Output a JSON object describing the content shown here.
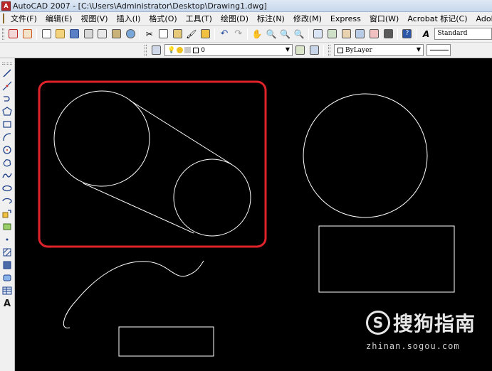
{
  "window": {
    "title": "AutoCAD 2007 - [C:\\Users\\Administrator\\Desktop\\Drawing1.dwg]"
  },
  "menu": {
    "items": [
      "文件(F)",
      "编辑(E)",
      "视图(V)",
      "插入(I)",
      "格式(O)",
      "工具(T)",
      "绘图(D)",
      "标注(N)",
      "修改(M)",
      "Express",
      "窗口(W)",
      "Acrobat 标记(C)",
      "Adobe PDF(B)"
    ]
  },
  "toolbar": {
    "text_style": "Standard",
    "layer_name": "0",
    "color_value": "ByLayer"
  },
  "left_toolbar": {
    "text_tool_label": "A"
  },
  "colors": {
    "canvas_bg": "#000000",
    "geometry": "#ffffff",
    "highlight": "#e0232a"
  },
  "watermark": {
    "logo_letter": "S",
    "brand": "搜狗指南",
    "url": "zhinan.sogou.com"
  }
}
